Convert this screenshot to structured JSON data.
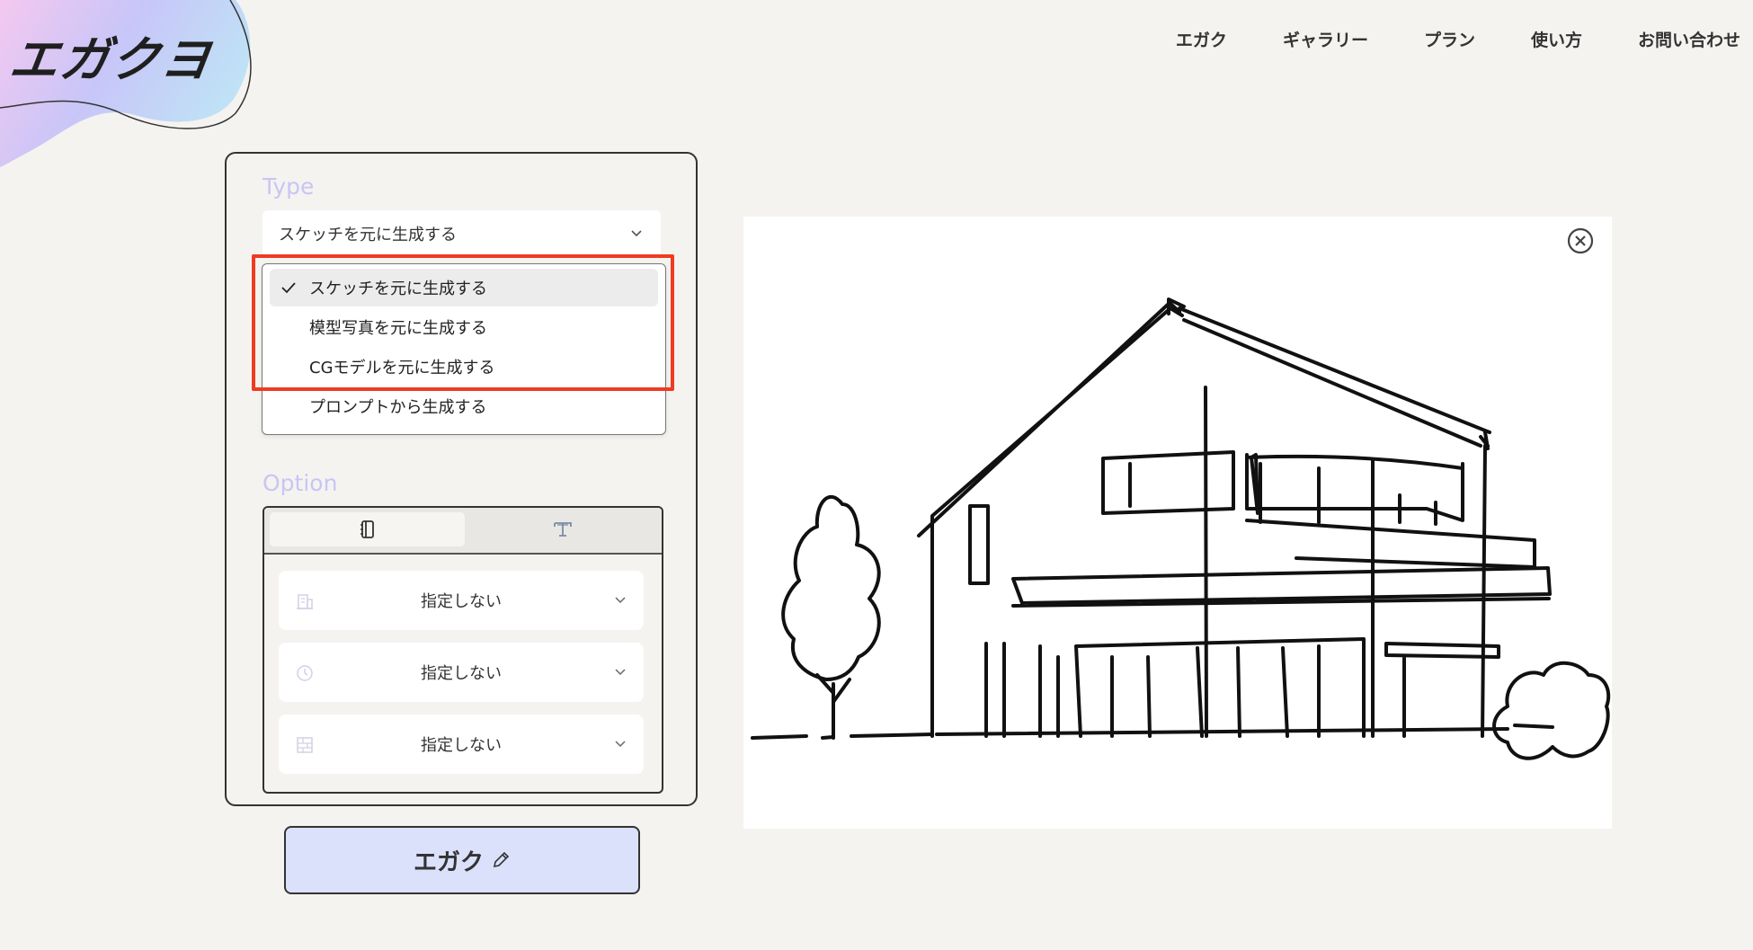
{
  "logo": {
    "text": "エガクヨ"
  },
  "nav": {
    "items": [
      {
        "label": "エガク"
      },
      {
        "label": "ギャラリー"
      },
      {
        "label": "プラン"
      },
      {
        "label": "使い方"
      },
      {
        "label": "お問い合わせ"
      }
    ]
  },
  "type_section": {
    "label": "Type",
    "selected_value": "スケッチを元に生成する",
    "options": [
      {
        "label": "スケッチを元に生成する",
        "selected": true
      },
      {
        "label": "模型写真を元に生成する",
        "selected": false
      },
      {
        "label": "CGモデルを元に生成する",
        "selected": false
      },
      {
        "label": "プロンプトから生成する",
        "selected": false
      }
    ]
  },
  "option_section": {
    "label": "Option",
    "tabs": [
      {
        "icon": "notebook-icon",
        "active": true
      },
      {
        "icon": "text-type-icon",
        "active": false
      }
    ],
    "selects": [
      {
        "icon": "building-icon",
        "value": "指定しない"
      },
      {
        "icon": "clock-icon",
        "value": "指定しない"
      },
      {
        "icon": "texture-grid-icon",
        "value": "指定しない"
      }
    ]
  },
  "generate_button": {
    "label": "エガク",
    "icon": "pencil-icon"
  },
  "canvas": {
    "content": "house-sketch-image",
    "close_icon": "close-circle-icon"
  },
  "colors": {
    "background": "#f4f3f0",
    "accent_label": "#c9c5f3",
    "button_bg": "#dbe1fb",
    "highlight_red": "#ee3b22"
  }
}
